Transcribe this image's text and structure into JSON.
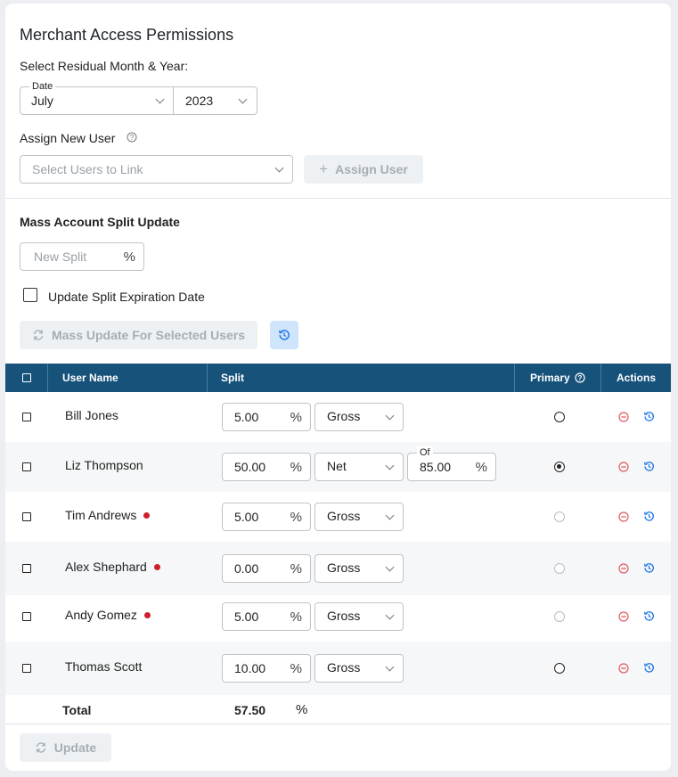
{
  "page": {
    "title": "Merchant Access Permissions",
    "residual_label": "Select Residual Month & Year:",
    "date": {
      "legend": "Date",
      "month": "July",
      "year": "2023"
    },
    "assign": {
      "label": "Assign New User",
      "placeholder": "Select Users to Link",
      "button": "Assign User"
    },
    "mass": {
      "title": "Mass Account Split Update",
      "split_placeholder": "New Split",
      "pct": "%",
      "expiration_label": "Update Split Expiration Date",
      "update_button": "Mass Update For Selected Users"
    }
  },
  "table": {
    "headers": {
      "user": "User Name",
      "split": "Split",
      "primary": "Primary",
      "actions": "Actions"
    },
    "rows": [
      {
        "name": "Bill Jones",
        "split": "5.00",
        "type": "Gross",
        "flag": false,
        "primary": "on-outline"
      },
      {
        "name": "Liz Thompson",
        "split": "50.00",
        "type": "Net",
        "of_label": "Of",
        "of_value": "85.00",
        "flag": false,
        "primary": "selected"
      },
      {
        "name": "Tim Andrews",
        "split": "5.00",
        "type": "Gross",
        "flag": true,
        "primary": "disabled"
      },
      {
        "name": "Alex Shephard",
        "split": "0.00",
        "type": "Gross",
        "flag": true,
        "primary": "disabled"
      },
      {
        "name": "Andy Gomez",
        "split": "5.00",
        "type": "Gross",
        "flag": true,
        "primary": "disabled"
      },
      {
        "name": "Thomas Scott",
        "split": "10.00",
        "type": "Gross",
        "flag": false,
        "primary": "on-outline"
      }
    ],
    "total_label": "Total",
    "total_value": "57.50",
    "total_pct": "%"
  },
  "footer": {
    "update_button": "Update"
  },
  "colors": {
    "header_bg": "#16527a",
    "accent": "#1a73e8",
    "danger": "#e05a62",
    "flag": "#cc1f2b"
  }
}
